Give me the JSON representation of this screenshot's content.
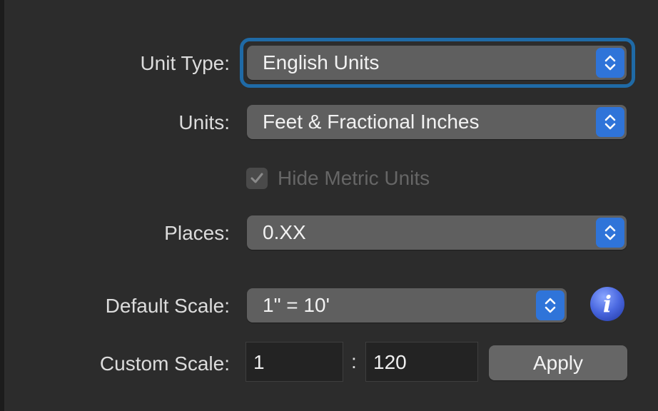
{
  "form": {
    "unit_type": {
      "label": "Unit Type:",
      "value": "English Units"
    },
    "units": {
      "label": "Units:",
      "value": "Feet & Fractional Inches"
    },
    "hide_metric": {
      "label": "Hide Metric Units",
      "checked": true,
      "enabled": false
    },
    "places": {
      "label": "Places:",
      "value": "0.XX"
    },
    "default_scale": {
      "label": "Default Scale:",
      "value": "1\" = 10'"
    },
    "custom_scale": {
      "label": "Custom Scale:",
      "numerator": "1",
      "separator": ":",
      "denominator": "120",
      "apply_label": "Apply"
    }
  },
  "icons": {
    "stepper": "up-down-chevron-icon",
    "checkmark": "checkmark-icon",
    "info": "info-icon"
  },
  "colors": {
    "accent": "#2f74d9",
    "focus_ring": "#1f6aa6",
    "background": "#2c2c2c"
  }
}
